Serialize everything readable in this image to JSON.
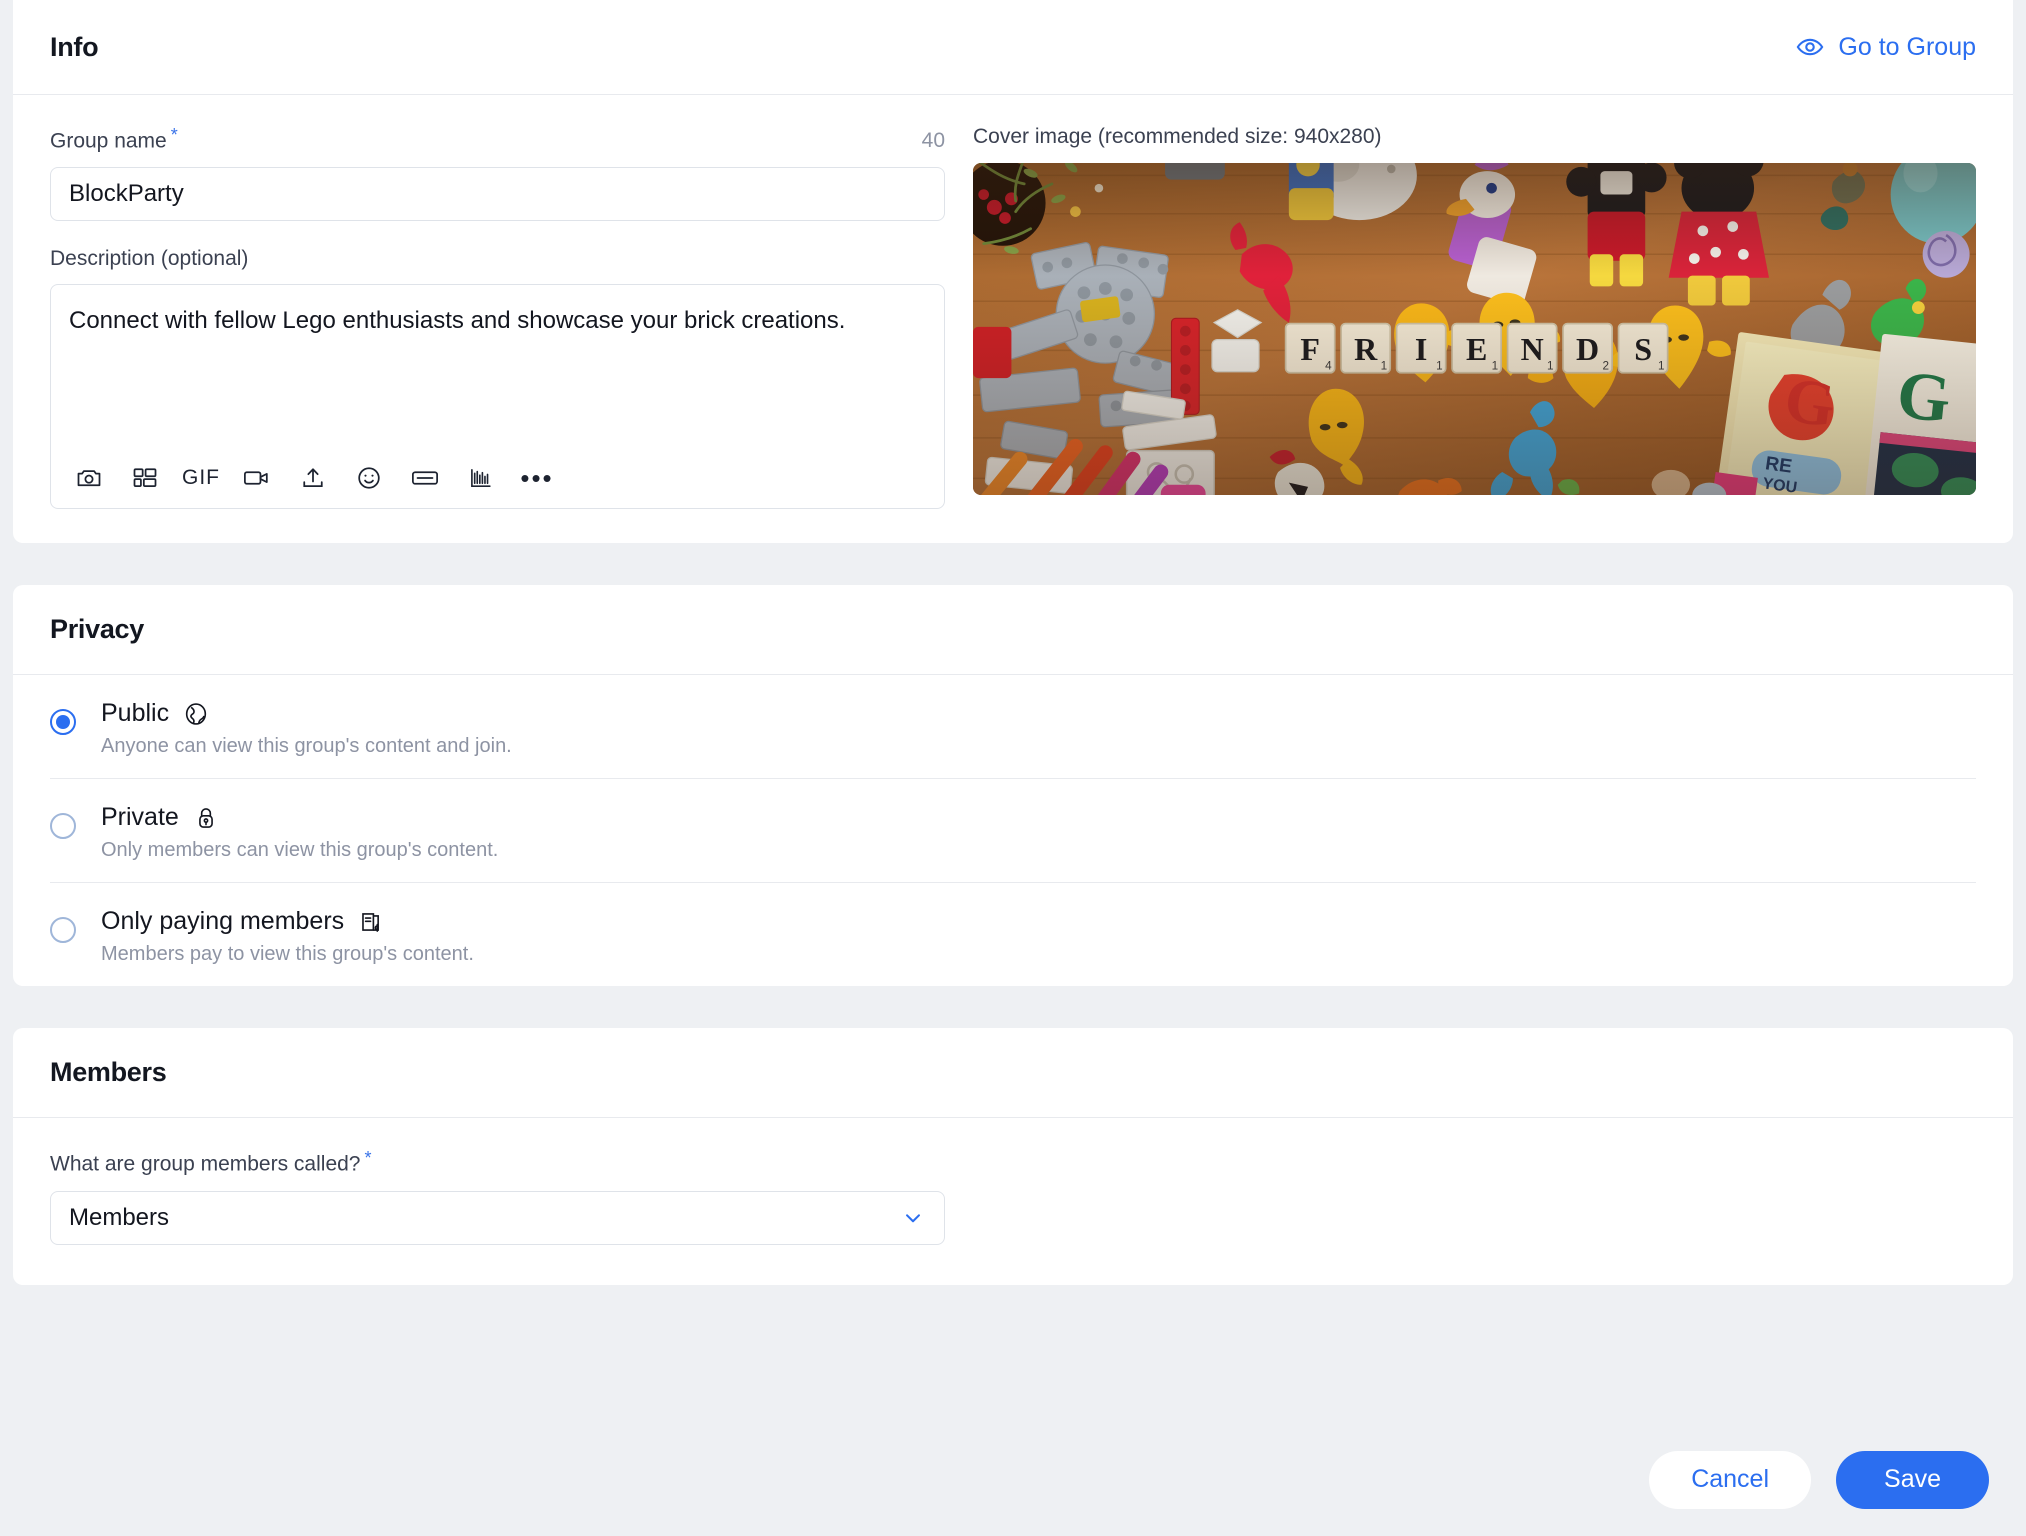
{
  "info": {
    "title": "Info",
    "go_to_group_label": "Go to Group",
    "go_to_group_icon": "eye-icon",
    "group_name_label": "Group name",
    "group_name_required_mark": "*",
    "group_name_char_count": "40",
    "group_name_value": "BlockParty",
    "description_label": "Description (optional)",
    "description_value": "Connect with fellow Lego enthusiasts and showcase your brick creations.",
    "editor_tools": [
      {
        "name": "camera-icon",
        "label": ""
      },
      {
        "name": "gallery-icon",
        "label": ""
      },
      {
        "name": "gif-icon",
        "label": "GIF"
      },
      {
        "name": "video-icon",
        "label": ""
      },
      {
        "name": "upload-icon",
        "label": ""
      },
      {
        "name": "emoji-icon",
        "label": ""
      },
      {
        "name": "poll-icon",
        "label": ""
      },
      {
        "name": "chart-icon",
        "label": ""
      },
      {
        "name": "more-options-icon",
        "label": "•••"
      }
    ],
    "cover_label": "Cover image (recommended size: 940x280)",
    "cover_alt": "Wooden table covered with Lego bricks, minifigures, crayons and yellow toys, with the word FRIENDS spelled in Scrabble tiles"
  },
  "privacy": {
    "title": "Privacy",
    "options": [
      {
        "label": "Public",
        "icon": "globe-icon",
        "description": "Anyone can view this group's content and join.",
        "selected": true
      },
      {
        "label": "Private",
        "icon": "lock-icon",
        "description": "Only members can view this group's content.",
        "selected": false
      },
      {
        "label": "Only paying members",
        "icon": "paid-content-icon",
        "description": "Members pay to view this group's content.",
        "selected": false
      }
    ]
  },
  "members": {
    "title": "Members",
    "question_label": "What are group members called?",
    "required_mark": "*",
    "selected_value": "Members",
    "chevron_icon": "chevron-down-icon"
  },
  "footer": {
    "cancel_label": "Cancel",
    "save_label": "Save"
  },
  "colors": {
    "accent": "#2b6ef0",
    "page_bg": "#eef0f3",
    "card_bg": "#ffffff",
    "text": "#13161f",
    "muted_text": "#8d93a3",
    "border": "#e8eaee"
  }
}
